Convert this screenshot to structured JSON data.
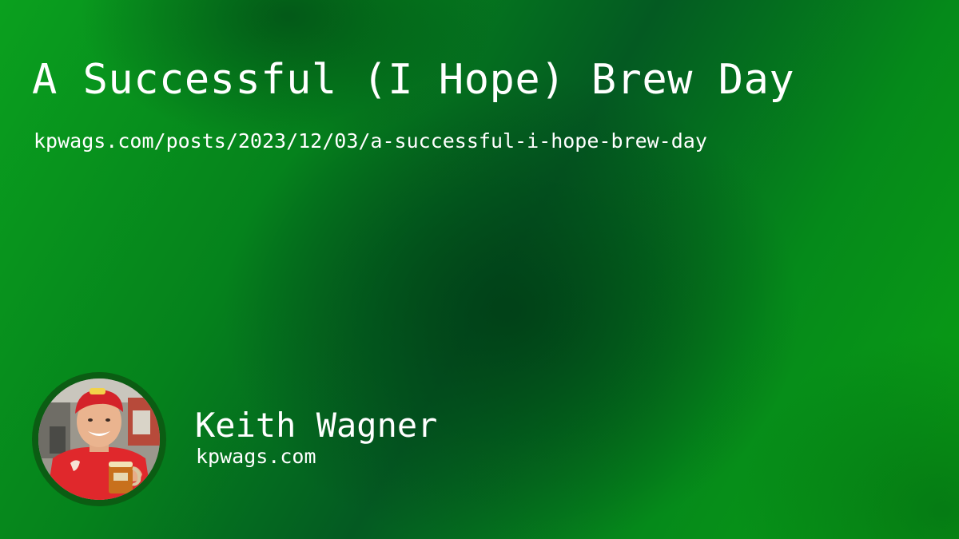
{
  "post": {
    "title": "A Successful (I Hope) Brew Day",
    "url": "kpwags.com/posts/2023/12/03/a-successful-i-hope-brew-day"
  },
  "author": {
    "name": "Keith Wagner",
    "site": "kpwags.com",
    "avatar_icon": "avatar-photo"
  },
  "colors": {
    "background_light": "#0aa01e",
    "background_dark": "#045a22",
    "avatar_ring": "#0b5d13",
    "text": "#ffffff"
  }
}
